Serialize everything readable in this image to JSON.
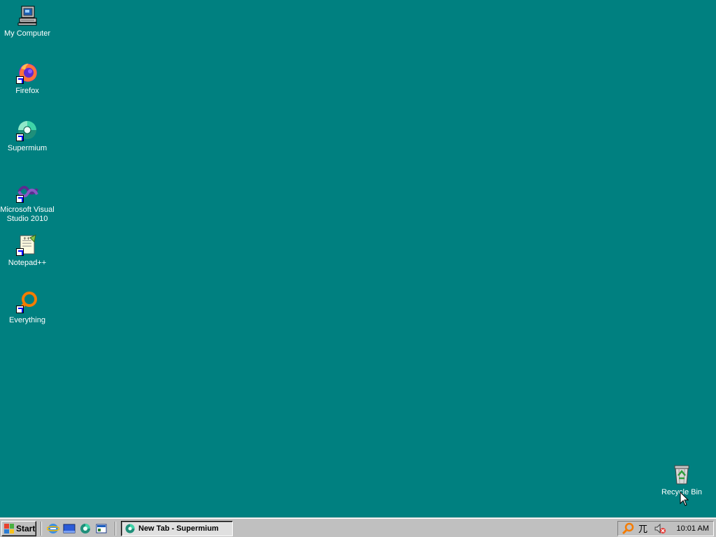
{
  "desktop": {
    "icons": [
      {
        "label": "My Computer",
        "icon": "computer-icon"
      },
      {
        "label": "Firefox",
        "icon": "firefox-icon"
      },
      {
        "label": "Supermium",
        "icon": "supermium-icon"
      },
      {
        "label": "Microsoft Visual Studio 2010",
        "icon": "visual-studio-icon"
      },
      {
        "label": "Notepad++",
        "icon": "notepad-plus-plus-icon"
      },
      {
        "label": "Everything",
        "icon": "everything-search-icon"
      },
      {
        "label": "Recycle Bin",
        "icon": "recycle-bin-icon"
      }
    ],
    "background_color": "#008080"
  },
  "taskbar": {
    "start_label": "Start",
    "quick_launch": [
      "internet-explorer-icon",
      "show-desktop-icon",
      "supermium-icon",
      "channels-icon"
    ],
    "tasks": [
      {
        "label": "New Tab - Supermium",
        "icon": "supermium-icon",
        "active": true
      }
    ],
    "tray": {
      "icons": [
        "everything-search-icon",
        "ime-language-icon",
        "volume-muted-icon"
      ],
      "clock": "10:01 AM"
    }
  }
}
